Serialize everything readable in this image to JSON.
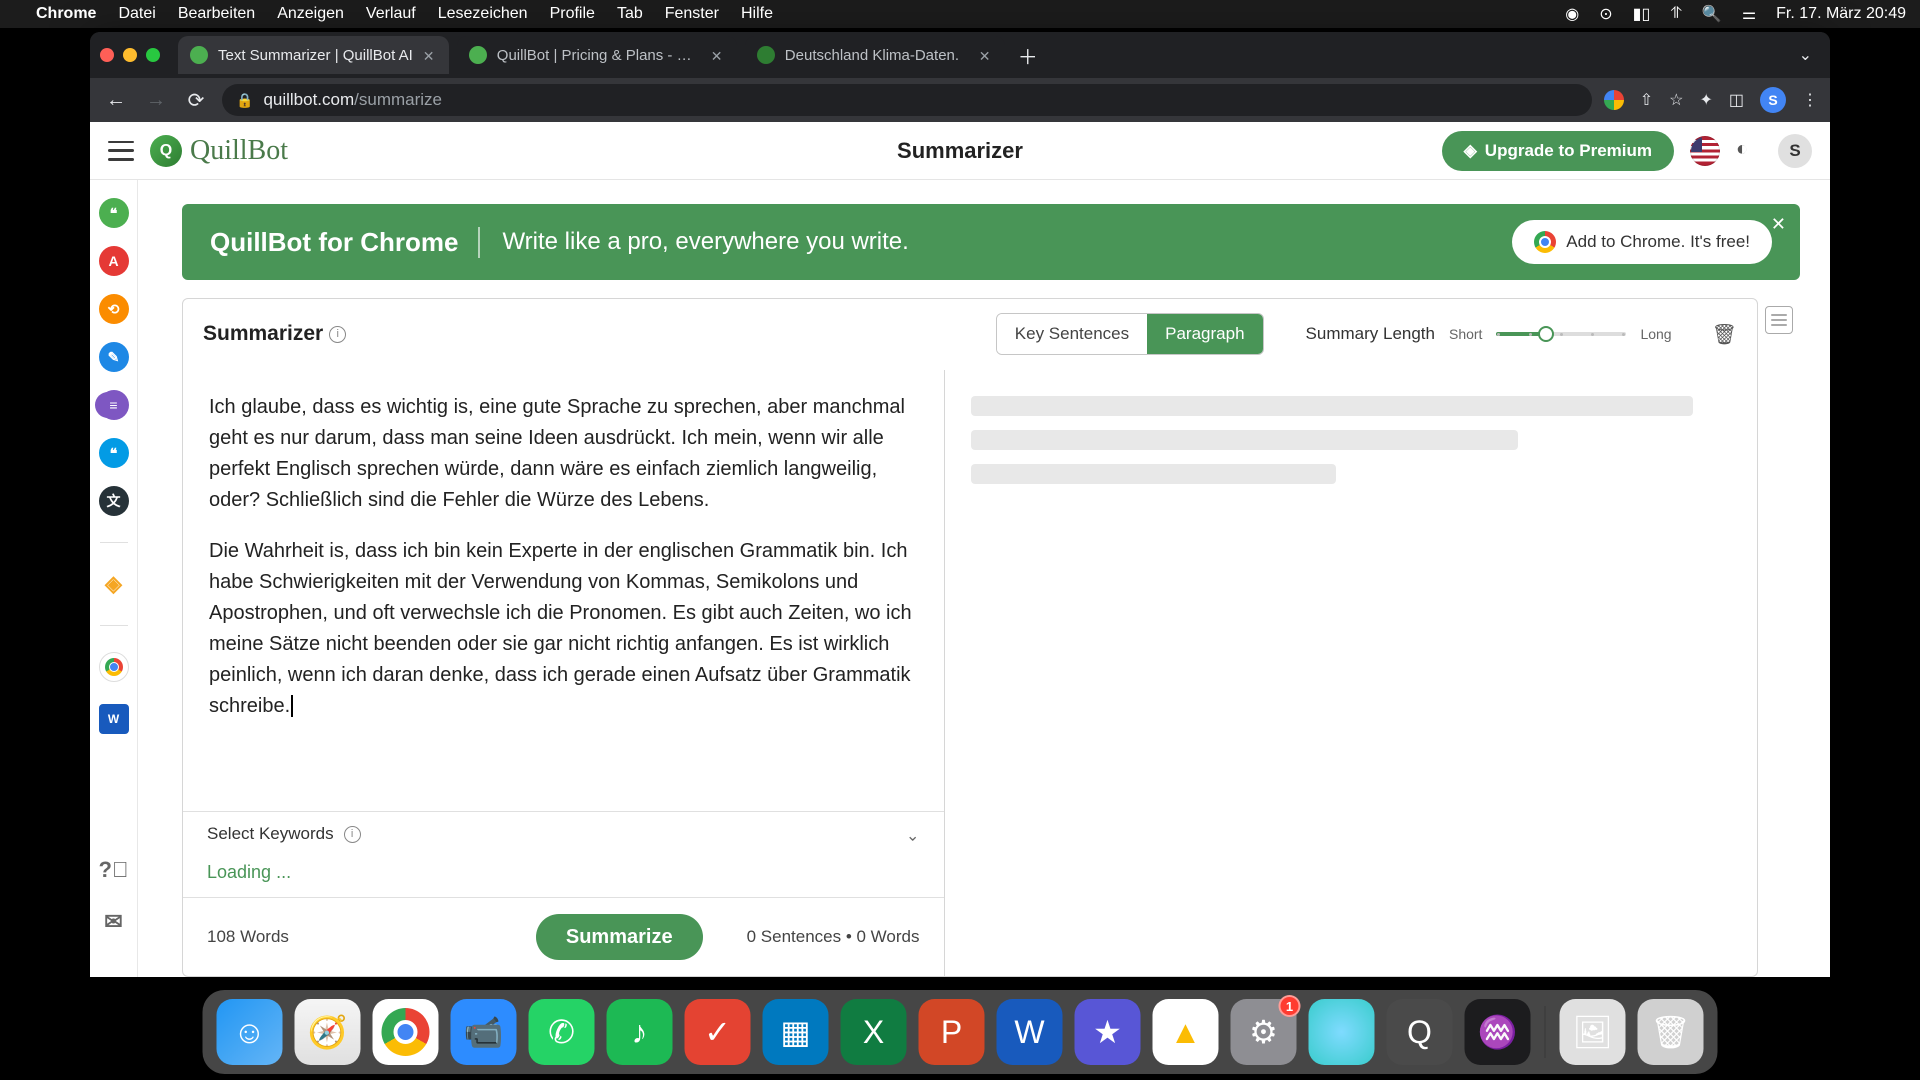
{
  "menubar": {
    "app": "Chrome",
    "items": [
      "Datei",
      "Bearbeiten",
      "Anzeigen",
      "Verlauf",
      "Lesezeichen",
      "Profile",
      "Tab",
      "Fenster",
      "Hilfe"
    ],
    "clock": "Fr. 17. März  20:49"
  },
  "tabs": [
    {
      "title": "Text Summarizer | QuillBot AI",
      "active": true,
      "favicon": "#4caf50"
    },
    {
      "title": "QuillBot | Pricing & Plans - Up…",
      "active": false,
      "favicon": "#4caf50"
    },
    {
      "title": "Deutschland Klima-Daten.",
      "active": false,
      "favicon": "#2e7d32"
    }
  ],
  "address": {
    "domain": "quillbot.com",
    "path": "/summarize"
  },
  "toolbar_profile": "S",
  "header": {
    "brand": "QuillBot",
    "title": "Summarizer",
    "premium": "Upgrade to Premium",
    "avatar": "S"
  },
  "banner": {
    "left": "QuillBot for Chrome",
    "mid": "Write like a pro, everywhere you write.",
    "cta": "Add to Chrome. It's free!"
  },
  "card": {
    "title": "Summarizer",
    "mode_key": "Key Sentences",
    "mode_para": "Paragraph",
    "length_label": "Summary Length",
    "length_short": "Short",
    "length_long": "Long",
    "keywords_label": "Select Keywords",
    "loading": "Loading ...",
    "word_count": "108 Words",
    "summarize_btn": "Summarize",
    "out_stats": "0 Sentences  •  0 Words"
  },
  "input_text": {
    "p1": "Ich glaube, dass es wichtig is, eine gute Sprache zu sprechen, aber manchmal geht es nur darum, dass man seine Ideen ausdrückt. Ich mein, wenn wir alle perfekt Englisch sprechen würde, dann wäre es einfach ziemlich langweilig, oder? Schließlich sind die Fehler die Würze des Lebens.",
    "p2": "Die Wahrheit is, dass ich bin kein Experte in der englischen Grammatik bin. Ich habe Schwierigkeiten mit der Verwendung von Kommas, Semikolons und Apostrophen, und oft verwechsle ich die Pronomen. Es gibt auch Zeiten, wo ich meine Sätze nicht beenden oder sie gar nicht richtig anfangen. Es ist wirklich peinlich, wenn ich daran denke, dass ich gerade einen Aufsatz über Grammatik schreibe."
  },
  "sidebar_icons": [
    {
      "name": "paraphraser-icon",
      "bg": "#4caf50",
      "txt": "❝"
    },
    {
      "name": "grammar-icon",
      "bg": "#e53935",
      "txt": "A"
    },
    {
      "name": "plagiarism-icon",
      "bg": "#fb8c00",
      "txt": "⟲"
    },
    {
      "name": "cowriter-icon",
      "bg": "#1e88e5",
      "txt": "✎"
    },
    {
      "name": "summarizer-icon",
      "bg": "#7e57c2",
      "txt": "≡",
      "active": true
    },
    {
      "name": "citation-icon",
      "bg": "#039be5",
      "txt": "❝"
    },
    {
      "name": "translator-icon",
      "bg": "#263238",
      "txt": "文"
    }
  ],
  "dock": [
    {
      "name": "finder",
      "bg": "linear-gradient(135deg,#2196f3,#64b5f6)",
      "txt": "☺"
    },
    {
      "name": "safari",
      "bg": "linear-gradient(#f5f5f5,#e0e0e0)",
      "txt": "🧭"
    },
    {
      "name": "chrome",
      "bg": "#fff",
      "txt": "",
      "chrome": true
    },
    {
      "name": "zoom",
      "bg": "#2d8cff",
      "txt": "📹"
    },
    {
      "name": "whatsapp",
      "bg": "#25d366",
      "txt": "✆"
    },
    {
      "name": "spotify",
      "bg": "#1db954",
      "txt": "♪"
    },
    {
      "name": "todoist",
      "bg": "#e44332",
      "txt": "✓"
    },
    {
      "name": "trello",
      "bg": "#0079bf",
      "txt": "▦"
    },
    {
      "name": "excel",
      "bg": "#107c41",
      "txt": "X"
    },
    {
      "name": "powerpoint",
      "bg": "#d24726",
      "txt": "P"
    },
    {
      "name": "word",
      "bg": "#185abd",
      "txt": "W"
    },
    {
      "name": "imovie",
      "bg": "#5856d6",
      "txt": "★"
    },
    {
      "name": "drive",
      "bg": "#fff",
      "txt": "▲",
      "txtcolor": "#fbbc04"
    },
    {
      "name": "settings",
      "bg": "#8e8e93",
      "txt": "⚙",
      "badge": "1"
    },
    {
      "name": "app1",
      "bg": "radial-gradient(#7fdbff,#39cccc)",
      "txt": ""
    },
    {
      "name": "quicktime",
      "bg": "#4a4a4a",
      "txt": "Q"
    },
    {
      "name": "audio",
      "bg": "#1c1c1e",
      "txt": "♒"
    }
  ],
  "dock_right": [
    {
      "name": "preview",
      "bg": "#e0e0e0",
      "txt": "🖼"
    },
    {
      "name": "trash",
      "bg": "#d0d0d0",
      "txt": "🗑"
    }
  ]
}
